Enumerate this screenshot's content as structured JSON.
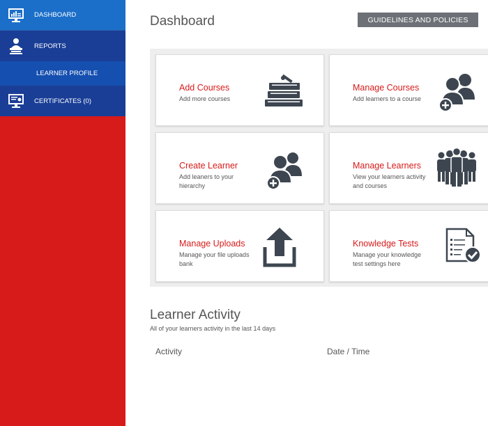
{
  "sidebar": {
    "items": [
      {
        "label": "DASHBOARD",
        "icon": "monitor-icon"
      },
      {
        "label": "REPORTS",
        "icon": "reports-icon"
      },
      {
        "label": "LEARNER PROFILE"
      },
      {
        "label": "CERTIFICATES (0)",
        "icon": "certificate-icon"
      }
    ]
  },
  "header": {
    "title": "Dashboard",
    "guidelines_label": "GUIDELINES AND POLICIES"
  },
  "cards": [
    {
      "title": "Add Courses",
      "desc": "Add more courses",
      "icon": "books-icon"
    },
    {
      "title": "Manage Courses",
      "desc": "Add learners to a course",
      "icon": "users-add-icon"
    },
    {
      "title": "Create Learner",
      "desc": "Add leaners to your hierarchy",
      "icon": "user-add-icon"
    },
    {
      "title": "Manage Learners",
      "desc": "View your learners activity and courses",
      "icon": "group-icon"
    },
    {
      "title": "Manage Uploads",
      "desc": "Manage your file uploads bank",
      "icon": "upload-icon"
    },
    {
      "title": "Knowledge Tests",
      "desc": "Manage your knowledge test settings here",
      "icon": "document-check-icon"
    }
  ],
  "activity": {
    "title": "Learner Activity",
    "subtitle": "All of your learners activity in the last 14 days",
    "columns": [
      "Activity",
      "Date / Time"
    ]
  },
  "colors": {
    "accent_red": "#d71a1a",
    "nav_blue": "#1a3e96",
    "nav_active": "#1b6fc9",
    "icon_gray": "#3d4650"
  }
}
